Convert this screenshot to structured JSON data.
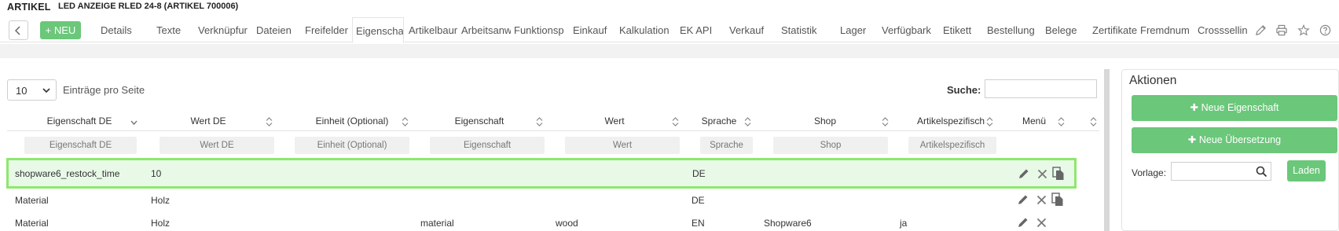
{
  "header": {
    "app": "ARTIKEL",
    "title": "LED ANZEIGE RLED 24-8 (ARTIKEL 700006)"
  },
  "toolbar": {
    "new_label": "+ NEU"
  },
  "tabs": [
    {
      "label": "Details"
    },
    {
      "label": "Texte"
    },
    {
      "label": "Verknüpfur"
    },
    {
      "label": "Dateien"
    },
    {
      "label": "Freifelder"
    },
    {
      "label": "Eigenschaf"
    },
    {
      "label": "Artikelbaur"
    },
    {
      "label": "Arbeitsanw"
    },
    {
      "label": "Funktionsp"
    },
    {
      "label": "Einkauf"
    },
    {
      "label": "Kalkulation"
    },
    {
      "label": "EK API"
    },
    {
      "label": "Verkauf"
    },
    {
      "label": "Statistik"
    },
    {
      "label": "Lager"
    },
    {
      "label": "Verfügbark"
    },
    {
      "label": "Etikett"
    },
    {
      "label": "Bestellung"
    },
    {
      "label": "Belege"
    },
    {
      "label": "Zertifikate"
    },
    {
      "label": "Fremdnum"
    },
    {
      "label": "Crosssellin"
    }
  ],
  "table": {
    "page_size": "10",
    "page_size_label": "Einträge pro Seite",
    "search_label": "Suche:",
    "columns": [
      "Eigenschaft DE",
      "Wert DE",
      "Einheit (Optional)",
      "Eigenschaft",
      "Wert",
      "Sprache",
      "Shop",
      "Artikelspezifisch",
      "Menü"
    ],
    "filters": [
      "Eigenschaft DE",
      "Wert DE",
      "Einheit (Optional)",
      "Eigenschaft",
      "Wert",
      "Sprache",
      "Shop",
      "Artikelspezifisch"
    ],
    "rows": [
      {
        "eig_de": "shopware6_restock_time",
        "wert_de": "10",
        "einheit": "",
        "eig": "",
        "wert": "",
        "sprache": "DE",
        "shop": "",
        "spez": ""
      },
      {
        "eig_de": "Material",
        "wert_de": "Holz",
        "einheit": "",
        "eig": "",
        "wert": "",
        "sprache": "DE",
        "shop": "",
        "spez": ""
      },
      {
        "eig_de": "Material",
        "wert_de": "Holz",
        "einheit": "",
        "eig": "material",
        "wert": "wood",
        "sprache": "EN",
        "shop": "Shopware6",
        "spez": "ja"
      }
    ]
  },
  "aside": {
    "title": "Aktionen",
    "new_property": "Neue Eigenschaft",
    "new_translation": "Neue Übersetzung",
    "template_label": "Vorlage:",
    "load_label": "Laden"
  },
  "colors": {
    "accent": "#6bc77a",
    "highlight_border": "#8de86d",
    "highlight_bg": "#e8f9e8"
  }
}
